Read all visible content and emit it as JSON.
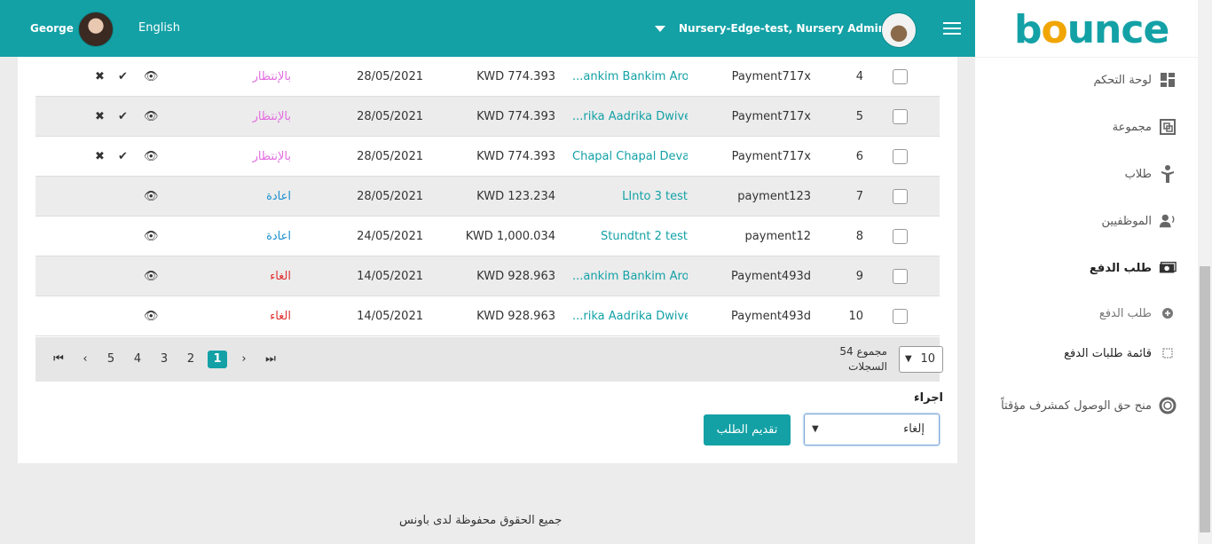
{
  "header": {
    "user_name": "George",
    "language": "English",
    "org_label": "Nursery-Edge-test, Nursery Admin"
  },
  "sidebar": {
    "logo_text_a": "b",
    "logo_text_dot": "o",
    "logo_text_b": "unce",
    "items": [
      {
        "label": "لوحة التحكم",
        "icon": "dashboard-icon"
      },
      {
        "label": "مجموعة",
        "icon": "group-icon"
      },
      {
        "label": "طلاب",
        "icon": "student-icon"
      },
      {
        "label": "الموظفيين",
        "icon": "staff-icon"
      },
      {
        "label": "طلب الدفع",
        "icon": "payment-icon"
      },
      {
        "label": "طلب الدفع",
        "icon": "plus-circle-icon"
      },
      {
        "label": "قائمة طلبات الدفع",
        "icon": "list-icon"
      },
      {
        "label": "منح حق الوصول كمشرف مؤقتاً",
        "icon": "lifebuoy-icon"
      }
    ]
  },
  "table": {
    "rows": [
      {
        "num": "4",
        "ref": "Payment717x",
        "name": "...ankim Bankim Arora",
        "amount": "KWD 774.393",
        "date": "28/05/2021",
        "status": "بالإنتظار",
        "status_type": "pending"
      },
      {
        "num": "5",
        "ref": "Payment717x",
        "name": "...rika Aadrika Dwivedi",
        "amount": "KWD 774.393",
        "date": "28/05/2021",
        "status": "بالإنتظار",
        "status_type": "pending"
      },
      {
        "num": "6",
        "ref": "Payment717x",
        "name": "Chapal Chapal Devar",
        "amount": "KWD 774.393",
        "date": "28/05/2021",
        "status": "بالإنتظار",
        "status_type": "pending"
      },
      {
        "num": "7",
        "ref": "payment123",
        "name": "LInto 3 test",
        "amount": "KWD 123.234",
        "date": "28/05/2021",
        "status": "اعادة",
        "status_type": "retry"
      },
      {
        "num": "8",
        "ref": "payment12",
        "name": "Stundtnt 2 test",
        "amount": "KWD 1,000.034",
        "date": "24/05/2021",
        "status": "اعادة",
        "status_type": "retry"
      },
      {
        "num": "9",
        "ref": "Payment493d",
        "name": "...ankim Bankim Arora",
        "amount": "KWD 928.963",
        "date": "14/05/2021",
        "status": "الغاء",
        "status_type": "cancel"
      },
      {
        "num": "10",
        "ref": "Payment493d",
        "name": "...rika Aadrika Dwivedi",
        "amount": "KWD 928.963",
        "date": "14/05/2021",
        "status": "الغاء",
        "status_type": "cancel"
      }
    ]
  },
  "pager": {
    "pages": [
      "5",
      "4",
      "3",
      "2",
      "1"
    ],
    "current": "1",
    "total_line1": "54 مجموع",
    "total_line2": "السجلات",
    "per_page": "10"
  },
  "action": {
    "label": "اجراء",
    "selected": "إلغاء",
    "submit_label": "تقديم الطلب"
  },
  "footer": {
    "text": "جميع الحقوق محفوظة لدى باونس"
  },
  "colors": {
    "accent": "#13a1a6",
    "pending": "#e36be0",
    "retry": "#1a8fd0",
    "cancel": "#e03030"
  }
}
